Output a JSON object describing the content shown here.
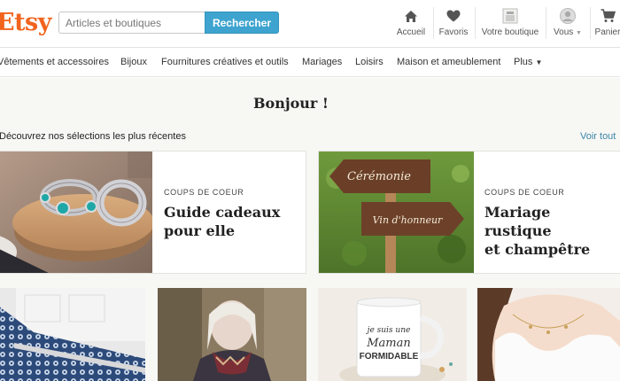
{
  "header": {
    "logo": "Etsy",
    "search": {
      "placeholder": "Articles et boutiques",
      "button": "Rechercher"
    },
    "nav": [
      {
        "label": "Accueil",
        "icon": "home-icon"
      },
      {
        "label": "Favoris",
        "icon": "heart-icon"
      },
      {
        "label": "Votre boutique",
        "icon": "shop-icon"
      },
      {
        "label": "Vous",
        "icon": "avatar-icon"
      },
      {
        "label": "Panier",
        "icon": "cart-icon"
      }
    ]
  },
  "categories": [
    "Vêtements et accessoires",
    "Bijoux",
    "Fournitures créatives et outils",
    "Mariages",
    "Loisirs",
    "Maison et ameublement",
    "Plus"
  ],
  "main": {
    "greeting": "Bonjour !",
    "subhead": "Découvrez nos sélections les plus récentes",
    "see_all": "Voir tout",
    "cards": [
      {
        "kicker": "COUPS DE COEUR",
        "title_line1": "Guide cadeaux",
        "title_line2": "pour elle"
      },
      {
        "kicker": "COUPS DE COEUR",
        "title_line1": "Mariage rustique",
        "title_line2": "et champêtre"
      }
    ],
    "signs": [
      "Cérémonie",
      "Vin d'honneur"
    ],
    "mug_text": [
      "je suis une",
      "Maman",
      "FORMIDABLE"
    ]
  },
  "colors": {
    "brand": "#f1641e",
    "search_button": "#3ea4cf",
    "link": "#3a86a8",
    "background": "#f7f7f4"
  }
}
